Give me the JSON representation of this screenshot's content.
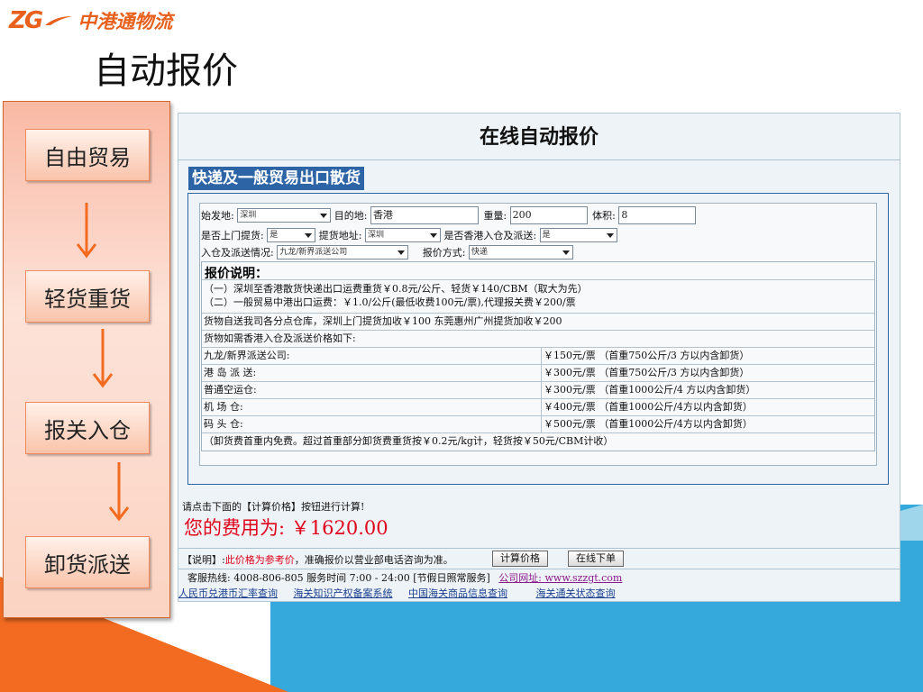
{
  "logo": {
    "mark": "ZG",
    "text": "中港通物流"
  },
  "slide_title": "自动报价",
  "flow": {
    "steps": [
      "自由贸易",
      "轻货重货",
      "报关入仓",
      "卸货派送"
    ],
    "arrow_color": "#f26b21"
  },
  "card": {
    "title": "在线自动报价",
    "tab": "快递及一般贸易出口散货",
    "form": {
      "origin_label": "始发地:",
      "origin_value": "深圳",
      "destination_label": "目的地:",
      "destination_value": "香港",
      "weight_label": "重量:",
      "weight_value": "200",
      "volume_label": "体积:",
      "volume_value": "8",
      "pickup_label": "是否上门提货:",
      "pickup_value": "是",
      "pickup_addr_label": "提货地址:",
      "pickup_addr_value": "深圳",
      "hk_delivery_label": "是否香港入仓及派送:",
      "hk_delivery_value": "是",
      "warehouse_label": "入仓及派送情况:",
      "warehouse_value": "九龙/新界派送公司",
      "quote_mode_label": "报价方式:",
      "quote_mode_value": "快递"
    },
    "price_notes": {
      "heading": "报价说明：",
      "line1": "（一）深圳至香港散货快递出口运费重货￥0.8元/公斤、轻货￥140/CBM（取大为先）",
      "line2": "（二）一般贸易中港出口运费：￥1.0/公斤(最低收费100元/票),代理报关费￥200/票",
      "line3": "货物自送我司各分点仓库，深圳上门提货加收￥100 东莞惠州广州提货加收￥200",
      "line4": "货物如需香港入仓及派送价格如下:",
      "rows": [
        {
          "name": "九龙/新界派送公司:",
          "price": "￥150元/票 （首重750公斤/3 方以内含卸货）"
        },
        {
          "name": "港 岛 派 送:",
          "price": "￥300元/票 （首重750公斤/3 方以内含卸货）"
        },
        {
          "name": "普通空运仓:",
          "price": "￥300元/票 （首重1000公斤/4 方以内含卸货）"
        },
        {
          "name": "机 场 仓:",
          "price": "￥400元/票 （首重1000公斤/4方以内含卸货）"
        },
        {
          "name": "码 头 仓:",
          "price": "￥500元/票 （首重1000公斤/4方以内含卸货）"
        }
      ],
      "footnote": "（卸货费首重内免费。超过首重部分卸货费重货按￥0.2元/kg计，轻货按￥50元/CBM计收）"
    },
    "calc_hint": "请点击下面的【计算价格】按钮进行计算!",
    "fee_text": "您的费用为: ￥1620.00",
    "bar": {
      "note_prefix": "【说明】:",
      "note_red": "此价格为参考价",
      "note_suffix": "，准确报价以营业部电话咨询为准。",
      "calc_button": "计算价格",
      "order_button": "在线下单"
    },
    "footer": {
      "hotline": "客服热线: 4008-806-805   服务时间 7:00 - 24:00   [节假日照常服务]",
      "site_link": "公司网址: www.szzgt.com",
      "links": [
        "人民币兑港币汇率查询",
        "海关知识产权备案系统",
        "中国海关商品信息查询",
        "海关通关状态查询"
      ]
    }
  },
  "colors": {
    "accent_orange": "#f26b21",
    "tab_blue": "#2d64a6",
    "fee_red": "#e0001b",
    "bg_blue": "#35a9dc"
  }
}
